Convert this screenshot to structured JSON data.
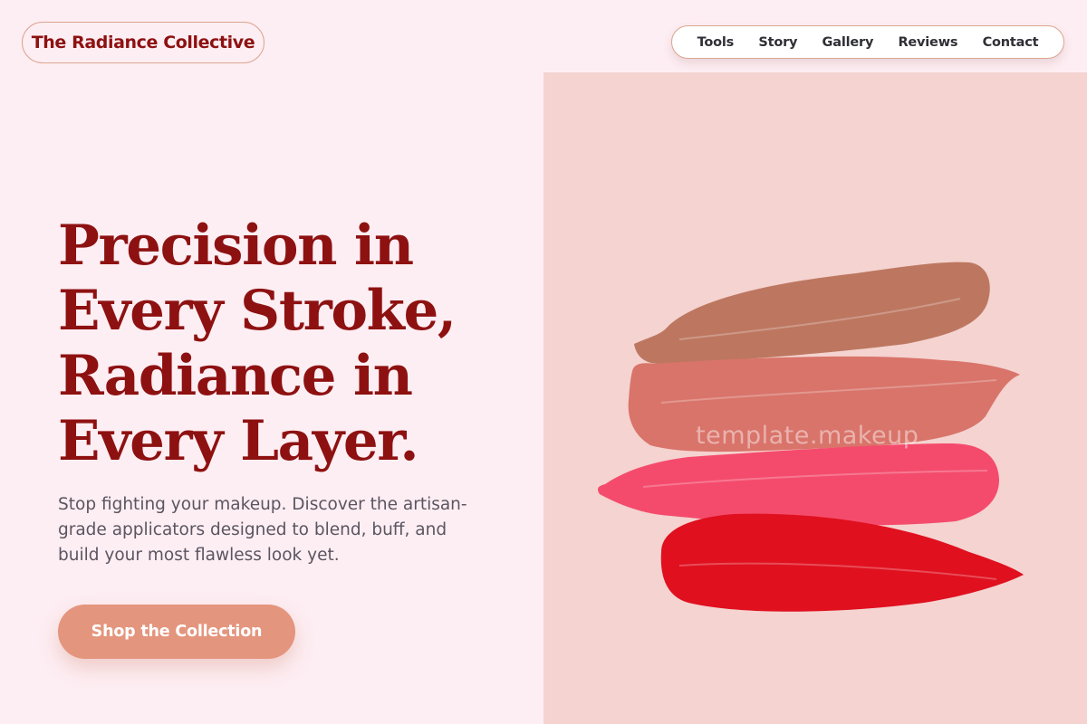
{
  "brand": {
    "name": "The Radiance Collective"
  },
  "nav": {
    "items": [
      "Tools",
      "Story",
      "Gallery",
      "Reviews",
      "Contact"
    ]
  },
  "hero": {
    "headline_lines": [
      "Precision in",
      "Every Stroke,",
      "Radiance in",
      "Every Layer."
    ],
    "subtitle": "Stop fighting your makeup. Discover the artisan-grade applicators designed to blend, buff, and build your most flawless look yet.",
    "cta_label": "Shop the Collection",
    "image": {
      "description_icon": "lipstick-swatches-image",
      "watermark": "template.makeup",
      "swatch_colors": [
        "#bd7760",
        "#d9746a",
        "#f44b6c",
        "#e0101f"
      ]
    }
  },
  "colors": {
    "background": "#fdeef3",
    "accent": "#8e1111",
    "button": "#e4957d",
    "image_background": "#f4d3d0"
  }
}
